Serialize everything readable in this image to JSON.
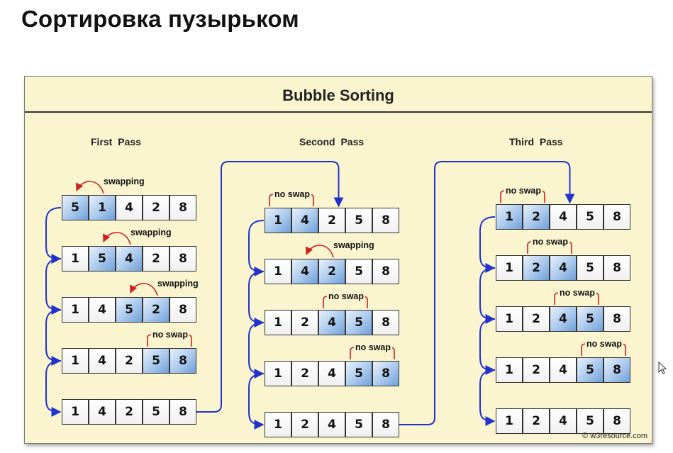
{
  "slide_title": "Сортировка пузырьком",
  "diagram": {
    "title": "Bubble  Sorting",
    "credit": "© w3resource.com",
    "colors": {
      "panel_background": "#fbf5cf",
      "highlight_cell": "#8fb6e6",
      "flow_arrow": "#2233cc",
      "swap_arrow": "#cc2222"
    },
    "passes": [
      {
        "label": "First  Pass",
        "steps": [
          {
            "values": [
              5,
              1,
              4,
              2,
              8
            ],
            "highlight": [
              0,
              1
            ],
            "note": "swapping"
          },
          {
            "values": [
              1,
              5,
              4,
              2,
              8
            ],
            "highlight": [
              1,
              2
            ],
            "note": "swapping"
          },
          {
            "values": [
              1,
              4,
              5,
              2,
              8
            ],
            "highlight": [
              2,
              3
            ],
            "note": "swapping"
          },
          {
            "values": [
              1,
              4,
              2,
              5,
              8
            ],
            "highlight": [
              3,
              4
            ],
            "note": "no swap"
          },
          {
            "values": [
              1,
              4,
              2,
              5,
              8
            ],
            "highlight": [],
            "note": ""
          }
        ]
      },
      {
        "label": "Second  Pass",
        "steps": [
          {
            "values": [
              1,
              4,
              2,
              5,
              8
            ],
            "highlight": [
              0,
              1
            ],
            "note": "no swap"
          },
          {
            "values": [
              1,
              4,
              2,
              5,
              8
            ],
            "highlight": [
              1,
              2
            ],
            "note": "swapping"
          },
          {
            "values": [
              1,
              2,
              4,
              5,
              8
            ],
            "highlight": [
              2,
              3
            ],
            "note": "no swap"
          },
          {
            "values": [
              1,
              2,
              4,
              5,
              8
            ],
            "highlight": [
              3,
              4
            ],
            "note": "no swap"
          },
          {
            "values": [
              1,
              2,
              4,
              5,
              8
            ],
            "highlight": [],
            "note": ""
          }
        ]
      },
      {
        "label": "Third  Pass",
        "steps": [
          {
            "values": [
              1,
              2,
              4,
              5,
              8
            ],
            "highlight": [
              0,
              1
            ],
            "note": "no swap"
          },
          {
            "values": [
              1,
              2,
              4,
              5,
              8
            ],
            "highlight": [
              1,
              2
            ],
            "note": "no swap"
          },
          {
            "values": [
              1,
              2,
              4,
              5,
              8
            ],
            "highlight": [
              2,
              3
            ],
            "note": "no swap"
          },
          {
            "values": [
              1,
              2,
              4,
              5,
              8
            ],
            "highlight": [
              3,
              4
            ],
            "note": "no swap"
          },
          {
            "values": [
              1,
              2,
              4,
              5,
              8
            ],
            "highlight": [],
            "note": ""
          }
        ]
      }
    ]
  }
}
